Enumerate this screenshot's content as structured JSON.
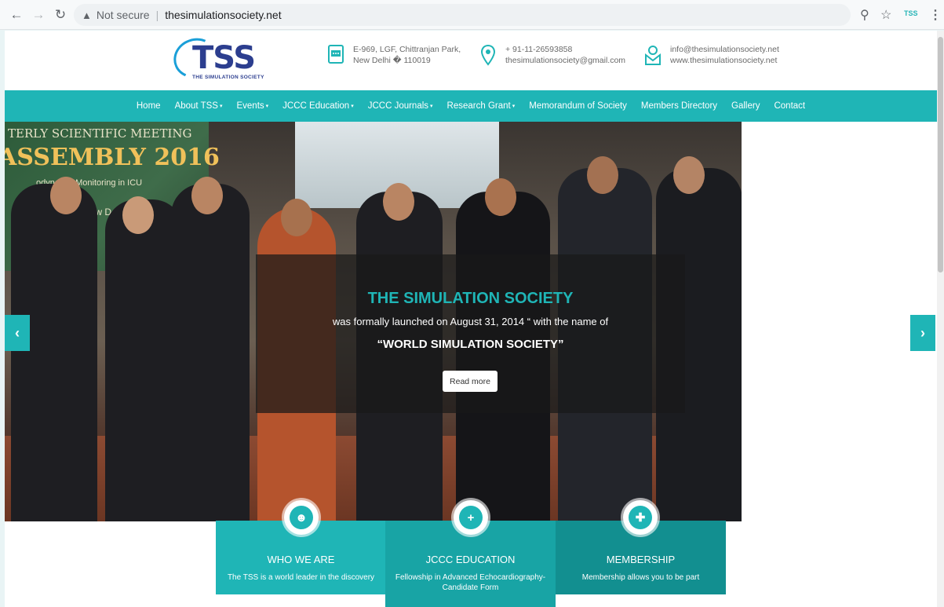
{
  "browser": {
    "security_label": "Not secure",
    "url": "thesimulationsociety.net",
    "extension_label": "TSS"
  },
  "header": {
    "logo_letters": "TSS",
    "logo_tagline": "THE SIMULATION SOCIETY",
    "address": [
      "E-969, LGF, Chittranjan Park,",
      "New Delhi � 110019"
    ],
    "phone": [
      "+ 91-11-26593858",
      "thesimulationsociety@gmail.com"
    ],
    "web": [
      "info@thesimulationsociety.net",
      "www.thesimulationsociety.net"
    ]
  },
  "nav": [
    {
      "label": "Home",
      "dropdown": false
    },
    {
      "label": "About TSS",
      "dropdown": true
    },
    {
      "label": "Events",
      "dropdown": true
    },
    {
      "label": "JCCC Education",
      "dropdown": true
    },
    {
      "label": "JCCC Journals",
      "dropdown": true
    },
    {
      "label": "Research Grant",
      "dropdown": true
    },
    {
      "label": "Memorandum of Society",
      "dropdown": false
    },
    {
      "label": "Members Directory",
      "dropdown": false
    },
    {
      "label": "Gallery",
      "dropdown": false
    },
    {
      "label": "Contact",
      "dropdown": false
    }
  ],
  "hero": {
    "banner_line1": "TERLY SCIENTIFIC MEETING",
    "banner_line2": "ASSEMBLY 2016",
    "banner_line3": "odynamic Monitoring in ICU",
    "banner_line4": "New Delhi",
    "caption_title": "THE SIMULATION SOCIETY",
    "caption_sub": "was formally launched on August 31, 2014 “ with the name of",
    "caption_name": "“WORLD SIMULATION SOCIETY”",
    "read_more": "Read more"
  },
  "features": [
    {
      "title": "WHO WE ARE",
      "desc": "The TSS is a world leader in the discovery",
      "icon": "people-icon"
    },
    {
      "title": "JCCC EDUCATION",
      "desc": "Fellowship in Advanced Echocardiography-Candidate Form",
      "icon": "location-plus-icon"
    },
    {
      "title": "MEMBERSHIP",
      "desc": "Membership allows you to be part",
      "icon": "add-user-icon"
    }
  ],
  "colors": {
    "accent": "#1fb5b6",
    "logo_blue": "#2c3e8f"
  }
}
